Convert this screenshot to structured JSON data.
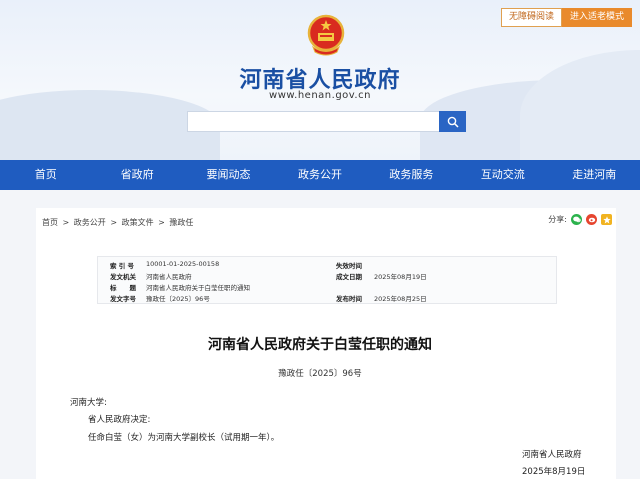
{
  "header": {
    "accessibility_label": "无障碍阅读",
    "elder_mode_label": "进入适老模式",
    "site_title": "河南省人民政府",
    "site_url": "www.henan.gov.cn",
    "search_placeholder": ""
  },
  "nav": {
    "items": [
      "首页",
      "省政府",
      "要闻动态",
      "政务公开",
      "政务服务",
      "互动交流",
      "走进河南"
    ]
  },
  "breadcrumb": {
    "items": [
      "首页",
      ">",
      "政务公开",
      ">",
      "政策文件",
      ">",
      "豫政任"
    ]
  },
  "share": {
    "label": "分享:"
  },
  "meta": {
    "index_label": "索 引 号",
    "index_value": "10001-01-2025-00158",
    "issuer_label": "发文机关",
    "issuer_value": "河南省人民政府",
    "subject_label": "标　　题",
    "subject_value": "河南省人民政府关于白莹任职的通知",
    "docno_label": "发文字号",
    "docno_value": "豫政任〔2025〕96号",
    "expiry_label": "失效时间",
    "expiry_value": "",
    "created_label": "成文日期",
    "created_value": "2025年08月19日",
    "published_label": "发布时间",
    "published_value": "2025年08月25日"
  },
  "document": {
    "title": "河南省人民政府关于白莹任职的通知",
    "number": "豫政任〔2025〕96号",
    "recipient": "河南大学:",
    "line1": "省人民政府决定:",
    "line2": "任命白莹（女）为河南大学副校长（试用期一年）。",
    "signer": "河南省人民政府",
    "date": "2025年8月19日"
  },
  "colors": {
    "nav_bg": "#1f5cc0",
    "title_blue": "#1a4fa3",
    "elder_btn": "#e98a2c"
  }
}
